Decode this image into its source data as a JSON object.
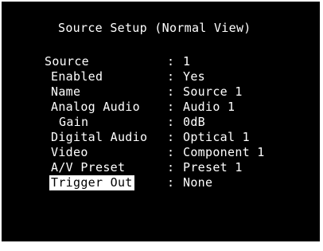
{
  "title": "Source Setup (Normal View)",
  "rows": [
    {
      "label": "Source",
      "value": "1",
      "indent": 0,
      "selected": false
    },
    {
      "label": "Enabled",
      "value": "Yes",
      "indent": 1,
      "selected": false
    },
    {
      "label": "Name",
      "value": "Source 1",
      "indent": 1,
      "selected": false
    },
    {
      "label": "Analog Audio",
      "value": "Audio 1",
      "indent": 1,
      "selected": false
    },
    {
      "label": "Gain",
      "value": "0dB",
      "indent": 2,
      "selected": false
    },
    {
      "label": "Digital Audio",
      "value": "Optical 1",
      "indent": 1,
      "selected": false
    },
    {
      "label": "Video",
      "value": "Component 1",
      "indent": 1,
      "selected": false
    },
    {
      "label": "A/V Preset",
      "value": "Preset 1",
      "indent": 1,
      "selected": false
    },
    {
      "label": "Trigger Out",
      "value": "None",
      "indent": 1,
      "selected": true
    }
  ],
  "separator": ":"
}
